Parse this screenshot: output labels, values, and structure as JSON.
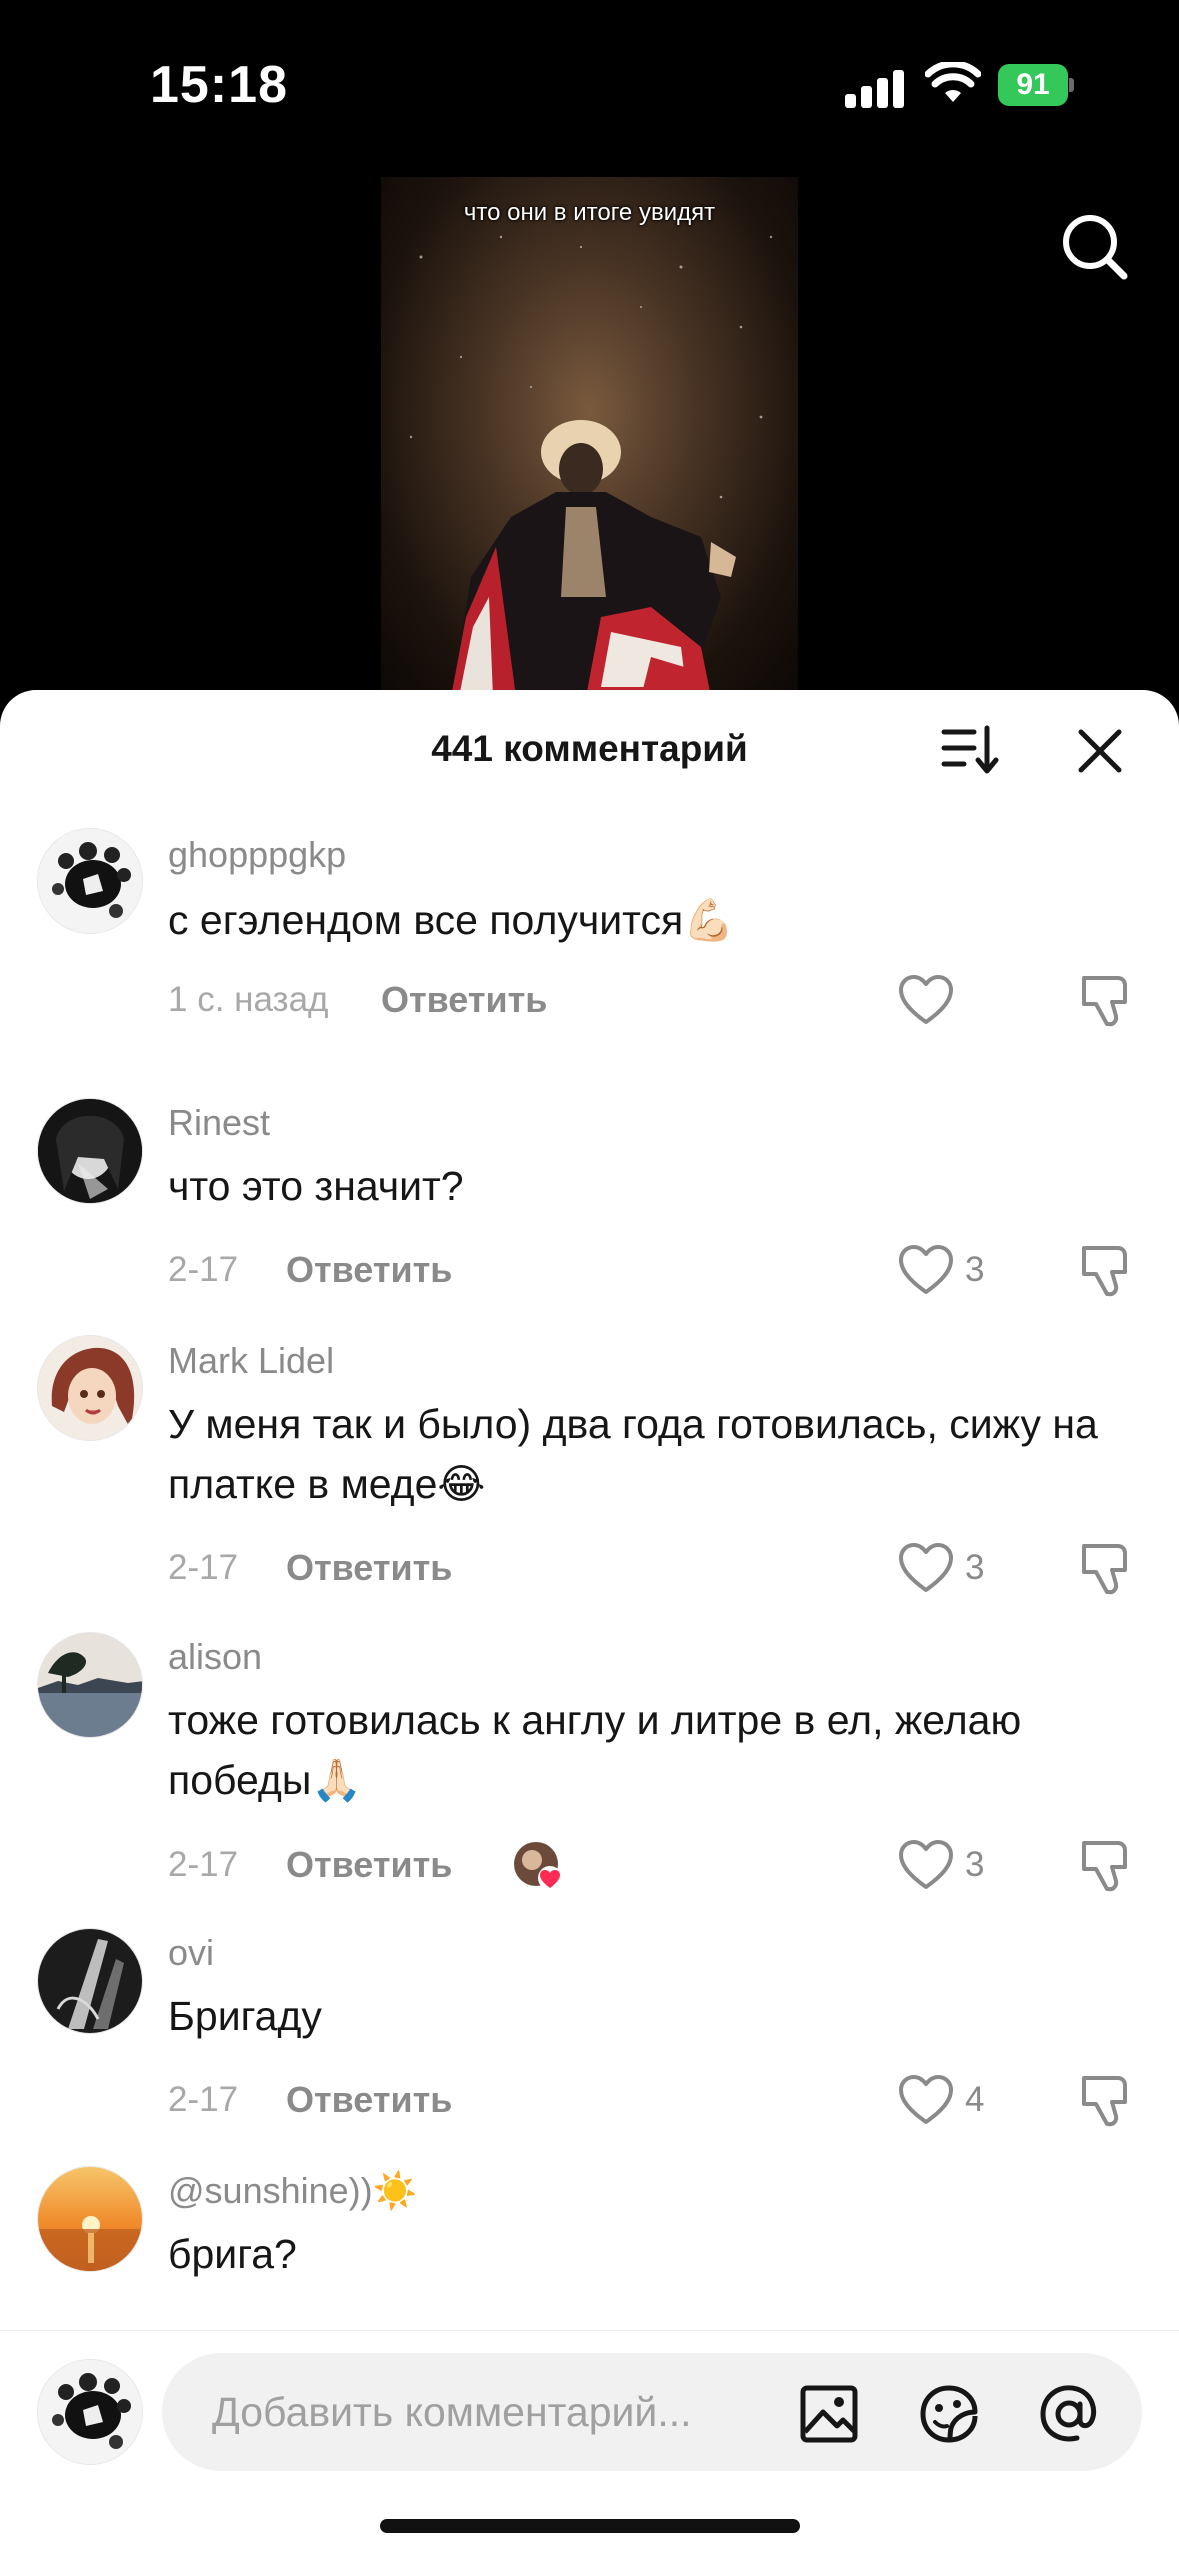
{
  "status_bar": {
    "time": "15:18",
    "battery": "91",
    "battery_color": "#34c759"
  },
  "video": {
    "caption": "что они в итоге увидят"
  },
  "sheet": {
    "title": "441 комментарий"
  },
  "comments": [
    {
      "username": "ghopppgkp",
      "text": "с егэлендом все получится💪🏻",
      "date": "1 с. назад",
      "reply": "Ответить",
      "likes": ""
    },
    {
      "username": "Rinest",
      "text": "что это значит?",
      "date": "2-17",
      "reply": "Ответить",
      "likes": "3"
    },
    {
      "username": "Mark Lidel",
      "text": "У меня так и было) два года готовилась, сижу на платке в меде😂",
      "date": "2-17",
      "reply": "Ответить",
      "likes": "3"
    },
    {
      "username": "alison",
      "text": "тоже готовилась к англу и литре в ел, желаю победы🙏🏻",
      "date": "2-17",
      "reply": "Ответить",
      "likes": "3"
    },
    {
      "username": "ovi",
      "text": "Бригаду",
      "date": "2-17",
      "reply": "Ответить",
      "likes": "4"
    },
    {
      "username": "@sunshine))☀️",
      "text": "брига?",
      "date": "",
      "reply": "",
      "likes": ""
    }
  ],
  "input": {
    "placeholder": "Добавить комментарий..."
  },
  "icons": {
    "search": "search-icon",
    "sort": "sort-icon",
    "close": "close-icon",
    "like": "heart-icon",
    "dislike": "dislike-icon",
    "image": "image-icon",
    "sticker": "sticker-icon",
    "mention": "at-icon"
  },
  "colors": {
    "like_red": "#fe2c55",
    "muted": "#8a8a8a"
  }
}
